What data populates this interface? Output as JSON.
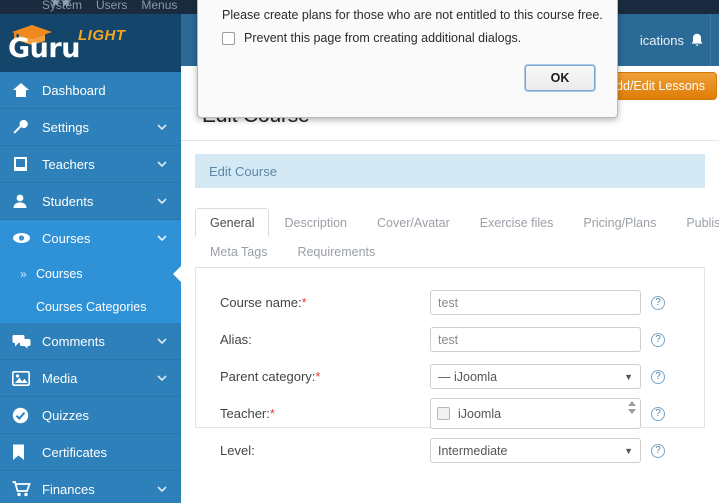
{
  "topbar": {
    "items": [
      "System",
      "Users",
      "Menus"
    ],
    "joomla_icon": "joomla-icon"
  },
  "sidebar": {
    "logo": {
      "name": "Guru",
      "badge": "LIGHT",
      "icon": "graduation-cap-icon"
    },
    "items": [
      {
        "label": "Dashboard",
        "icon": "home-icon",
        "expandable": false,
        "active": false
      },
      {
        "label": "Settings",
        "icon": "wrench-icon",
        "expandable": true,
        "active": false
      },
      {
        "label": "Teachers",
        "icon": "book-icon",
        "expandable": true,
        "active": false
      },
      {
        "label": "Students",
        "icon": "user-icon",
        "expandable": true,
        "active": false
      },
      {
        "label": "Courses",
        "icon": "eye-icon",
        "expandable": true,
        "active": true
      },
      {
        "label": "Comments",
        "icon": "comments-icon",
        "expandable": true,
        "active": false
      },
      {
        "label": "Media",
        "icon": "image-icon",
        "expandable": true,
        "active": false
      },
      {
        "label": "Quizzes",
        "icon": "check-circle-icon",
        "expandable": false,
        "active": false
      },
      {
        "label": "Certificates",
        "icon": "bookmark-icon",
        "expandable": false,
        "active": false
      },
      {
        "label": "Finances",
        "icon": "cart-icon",
        "expandable": true,
        "active": false
      }
    ],
    "submenu": [
      {
        "label": "Courses",
        "current": true
      },
      {
        "label": "Courses Categories",
        "current": false
      }
    ]
  },
  "header": {
    "notifications_label": "ications",
    "bell_icon": "bell-icon"
  },
  "toolbar": {
    "lessons_button": "dd/Edit Lessons"
  },
  "page": {
    "title": "Edit Course",
    "breadcrumb": "Edit Course"
  },
  "tabs": {
    "row1": [
      {
        "label": "General",
        "active": true
      },
      {
        "label": "Description",
        "active": false
      },
      {
        "label": "Cover/Avatar",
        "active": false
      },
      {
        "label": "Exercise files",
        "active": false
      },
      {
        "label": "Pricing/Plans",
        "active": false
      },
      {
        "label": "Publishing",
        "active": false
      }
    ],
    "row2": [
      {
        "label": "Meta Tags",
        "active": false
      },
      {
        "label": "Requirements",
        "active": false
      }
    ]
  },
  "form": {
    "help_icon": "help-icon",
    "fields": [
      {
        "label": "Course name:",
        "required": true,
        "type": "text",
        "value": "test"
      },
      {
        "label": "Alias:",
        "required": false,
        "type": "text",
        "value": "test"
      },
      {
        "label": "Parent category:",
        "required": true,
        "type": "select",
        "value": "— iJoomla"
      },
      {
        "label": "Teacher:",
        "required": true,
        "type": "multiselect",
        "value": "iJoomla"
      },
      {
        "label": "Level:",
        "required": false,
        "type": "select",
        "value": "Intermediate"
      }
    ]
  },
  "dialog": {
    "message": "Please create plans for those who are not entitled to this course free.",
    "checkbox_label": "Prevent this page from creating additional dialogs.",
    "ok_label": "OK"
  }
}
